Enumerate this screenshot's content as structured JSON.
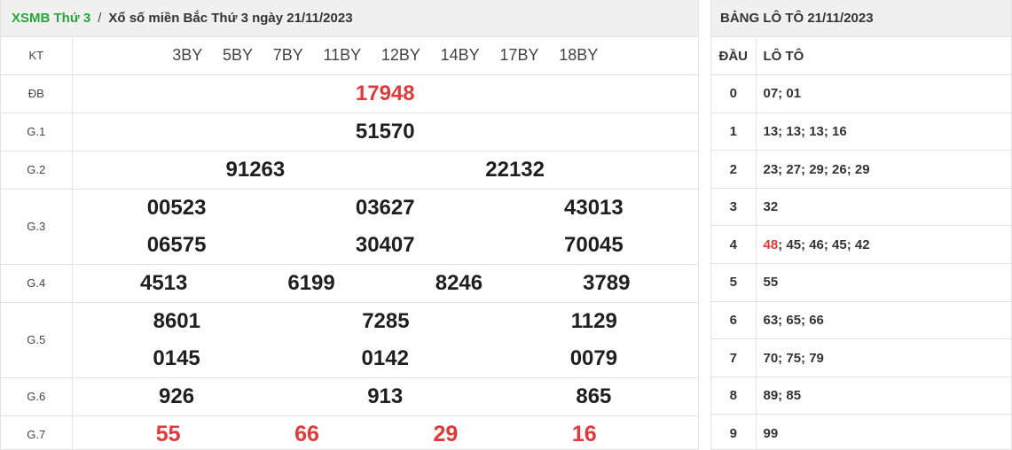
{
  "header": {
    "link": "XSMB Thứ 3",
    "separator": "/",
    "title": "Xổ số miền Bắc Thứ 3 ngày 21/11/2023"
  },
  "results": {
    "kt_label": "KT",
    "codes": [
      "3BY",
      "5BY",
      "7BY",
      "11BY",
      "12BY",
      "14BY",
      "17BY",
      "18BY"
    ],
    "prizes": [
      {
        "label": "ĐB",
        "lines": [
          [
            "17948"
          ]
        ]
      },
      {
        "label": "G.1",
        "lines": [
          [
            "51570"
          ]
        ]
      },
      {
        "label": "G.2",
        "lines": [
          [
            "91263",
            "22132"
          ]
        ]
      },
      {
        "label": "G.3",
        "lines": [
          [
            "00523",
            "03627",
            "43013"
          ],
          [
            "06575",
            "30407",
            "70045"
          ]
        ]
      },
      {
        "label": "G.4",
        "lines": [
          [
            "4513",
            "6199",
            "8246",
            "3789"
          ]
        ]
      },
      {
        "label": "G.5",
        "lines": [
          [
            "8601",
            "7285",
            "1129"
          ],
          [
            "0145",
            "0142",
            "0079"
          ]
        ]
      },
      {
        "label": "G.6",
        "lines": [
          [
            "926",
            "913",
            "865"
          ]
        ]
      },
      {
        "label": "G.7",
        "lines": [
          [
            "55",
            "66",
            "29",
            "16"
          ]
        ]
      }
    ]
  },
  "loto": {
    "title": "BẢNG LÔ TÔ 21/11/2023",
    "col_dau": "ĐẦU",
    "col_loto": "LÔ TÔ",
    "rows": [
      {
        "dau": "0",
        "values": "07; 01"
      },
      {
        "dau": "1",
        "values": "13; 13; 13; 16"
      },
      {
        "dau": "2",
        "values": "23; 27; 29; 26; 29"
      },
      {
        "dau": "3",
        "values": "32"
      },
      {
        "dau": "4",
        "highlight": "48",
        "rest": "; 45; 46; 45; 42"
      },
      {
        "dau": "5",
        "values": "55"
      },
      {
        "dau": "6",
        "values": "63; 65; 66"
      },
      {
        "dau": "7",
        "values": "70; 75; 79"
      },
      {
        "dau": "8",
        "values": "89; 85"
      },
      {
        "dau": "9",
        "values": "99"
      }
    ]
  },
  "colors": {
    "accent_green": "#27a43c",
    "special_red": "#e23a3a",
    "header_bg": "#f0f0f0"
  }
}
